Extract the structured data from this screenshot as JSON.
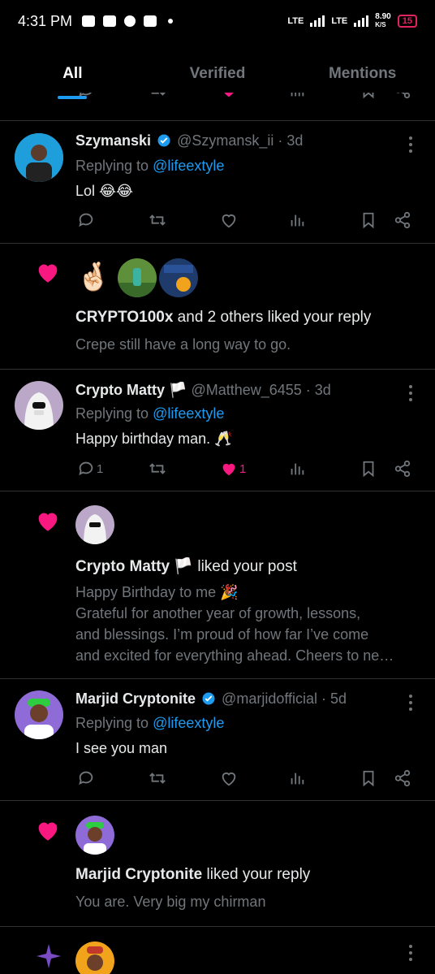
{
  "status": {
    "time": "4:31 PM",
    "network_1": "LTE",
    "network_2": "LTE",
    "speed_value": "8.90",
    "speed_unit": "K/S",
    "battery": "15"
  },
  "tabs": [
    {
      "label": "All"
    },
    {
      "label": "Verified"
    },
    {
      "label": "Mentions"
    }
  ],
  "tweets": [
    {
      "name": "Szymanski",
      "handle": "@Szymansk_ii · 3d",
      "replying_prefix": "Replying to ",
      "replying_to": "@lifeextyle",
      "text": "Lol 😂😂",
      "reply_count": "",
      "like_count": ""
    },
    {
      "name": "Crypto Matty 🏳️",
      "handle": "@Matthew_6455 · 3d",
      "replying_prefix": "Replying to ",
      "replying_to": "@lifeextyle",
      "text": "Happy birthday man. 🥂",
      "reply_count": "1",
      "like_count": "1"
    },
    {
      "name": "Marjid Cryptonite",
      "handle": "@marjidofficial · 5d",
      "replying_prefix": "Replying to ",
      "replying_to": "@lifeextyle",
      "text": "I see you man",
      "reply_count": "",
      "like_count": ""
    }
  ],
  "notifications": [
    {
      "actor": "CRYPTO100x",
      "action": " and 2 others liked your reply",
      "body": "Crepe still have a long way to go.",
      "emoji": "🤞🏻"
    },
    {
      "actor": "Crypto Matty 🏳️",
      "action": " liked your post",
      "body_lines": [
        "Happy Birthday to me 🎉",
        "Grateful for another year of growth, lessons,",
        "and blessings. I’m proud of how far I’ve come",
        "and excited for everything ahead. Cheers to ne…"
      ]
    },
    {
      "actor": "Marjid Cryptonite",
      "action": " liked your reply",
      "body": "You are. Very big my chirman"
    }
  ],
  "colors": {
    "accent": "#1d9bf0",
    "like": "#f91880",
    "muted": "#71767b",
    "divider": "#2f3336",
    "sparkle": "#794bc4"
  }
}
